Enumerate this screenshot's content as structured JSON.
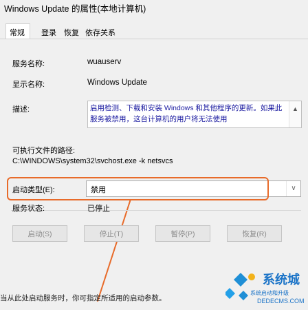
{
  "window": {
    "title": "Windows Update 的属性(本地计算机)"
  },
  "tabs": [
    "常规",
    "登录",
    "恢复",
    "依存关系"
  ],
  "fields": {
    "service_name_label": "服务名称:",
    "service_name_value": "wuauserv",
    "display_name_label": "显示名称:",
    "display_name_value": "Windows Update",
    "description_label": "描述:",
    "description_value": "启用检测、下载和安装 Windows 和其他程序的更新。如果此服务被禁用，这台计算机的用户将无法使用",
    "exe_path_label": "可执行文件的路径:",
    "exe_path_value": "C:\\WINDOWS\\system32\\svchost.exe -k netsvcs",
    "startup_type_label": "启动类型(E):",
    "startup_type_value": "禁用",
    "status_label": "服务状态:",
    "status_value": "已停止"
  },
  "buttons": {
    "start": "启动(S)",
    "stop": "停止(T)",
    "pause": "暂停(P)",
    "resume": "恢复(R)"
  },
  "footnote": "当从此处启动服务时，你可指定所适用的启动参数。",
  "watermark": {
    "brand": "系统城",
    "tagline": "系统启动和升级",
    "site": "DEDECMS.COM"
  },
  "colors": {
    "highlight": "#e86b2a"
  }
}
